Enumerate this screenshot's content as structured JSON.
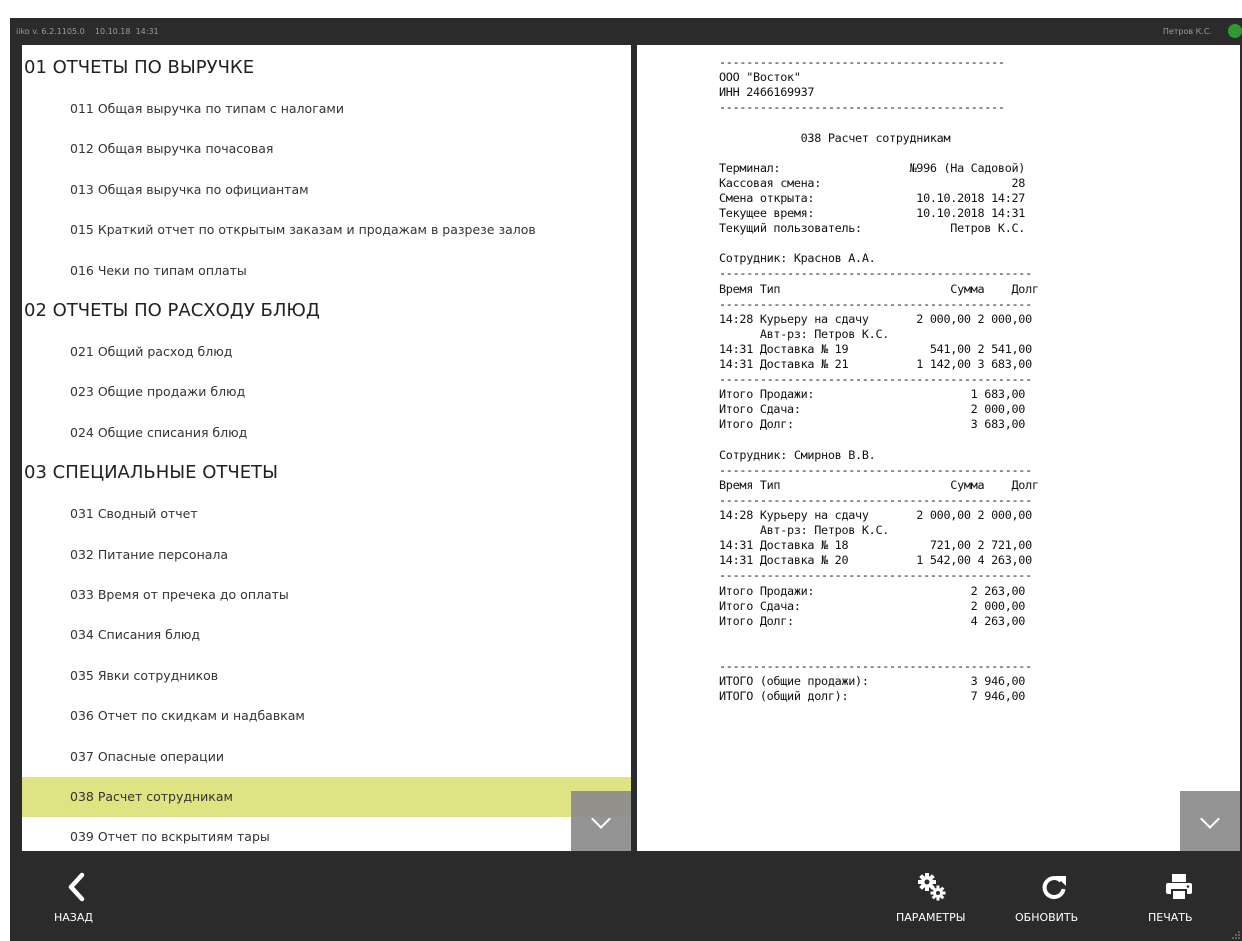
{
  "titlebar": {
    "app_info": "iiko v. 6.2.1105.0    10.10.18  14:31",
    "user": "Петров К.С."
  },
  "sections": [
    {
      "title": "01 ОТЧЕТЫ ПО ВЫРУЧКЕ",
      "items": [
        "011 Общая выручка по типам с налогами",
        "012 Общая выручка почасовая",
        "013 Общая выручка по официантам",
        "015 Краткий отчет по открытым заказам и продажам в разрезе залов",
        "016 Чеки по типам оплаты"
      ]
    },
    {
      "title": "02 ОТЧЕТЫ ПО РАСХОДУ БЛЮД",
      "items": [
        "021 Общий расход блюд",
        "023 Общие продажи блюд",
        "024 Общие списания блюд"
      ]
    },
    {
      "title": "03 СПЕЦИАЛЬНЫЕ ОТЧЕТЫ",
      "items": [
        "031 Сводный отчет",
        "032 Питание персонала",
        "033 Время от пречека до оплаты",
        "034 Списания блюд",
        "035 Явки сотрудников",
        "036 Отчет по скидкам и надбавкам",
        "037 Опасные операции",
        "038 Расчет сотрудникам",
        "039 Отчет по вскрытиям тары"
      ]
    }
  ],
  "selected_item": "038 Расчет сотрудникам",
  "receipt_lines": [
    "------------------------------------------",
    "ООО \"Восток\"",
    "ИНН 2466169937",
    "------------------------------------------",
    "",
    "            038 Расчет сотрудникам",
    "",
    "Терминал:                   №996 (На Садовой)",
    "Кассовая смена:                            28",
    "Смена открыта:               10.10.2018 14:27",
    "Текущее время:               10.10.2018 14:31",
    "Текущий пользователь:             Петров К.С.",
    "",
    "Сотрудник: Краснов А.А.",
    "----------------------------------------------",
    "Время Тип                         Сумма    Долг",
    "----------------------------------------------",
    "14:28 Курьеру на сдачу       2 000,00 2 000,00",
    "      Авт-рз: Петров К.С.",
    "14:31 Доставка № 19            541,00 2 541,00",
    "14:31 Доставка № 21          1 142,00 3 683,00",
    "----------------------------------------------",
    "Итого Продажи:                       1 683,00",
    "Итого Сдача:                         2 000,00",
    "Итого Долг:                          3 683,00",
    "",
    "Сотрудник: Смирнов В.В.",
    "----------------------------------------------",
    "Время Тип                         Сумма    Долг",
    "----------------------------------------------",
    "14:28 Курьеру на сдачу       2 000,00 2 000,00",
    "      Авт-рз: Петров К.С.",
    "14:31 Доставка № 18            721,00 2 721,00",
    "14:31 Доставка № 20          1 542,00 4 263,00",
    "----------------------------------------------",
    "Итого Продажи:                       2 263,00",
    "Итого Сдача:                         2 000,00",
    "Итого Долг:                          4 263,00",
    "",
    "",
    "----------------------------------------------",
    "ИТОГО (общие продажи):               3 946,00",
    "ИТОГО (общий долг):                  7 946,00"
  ],
  "toolbar": {
    "back_label": "НАЗАД",
    "params_label": "ПАРАМЕТРЫ",
    "refresh_label": "ОБНОВИТЬ",
    "print_label": "ПЕЧАТЬ"
  },
  "icons": {
    "back": "chevron-left-icon",
    "params": "gears-icon",
    "refresh": "refresh-icon",
    "print": "printer-icon",
    "scroll": "chevron-down-icon",
    "status": "status-dot-icon"
  },
  "colors": {
    "selected_highlight": "#dfe381",
    "status_green": "#2e9a2e",
    "chrome": "#2b2b2b"
  }
}
